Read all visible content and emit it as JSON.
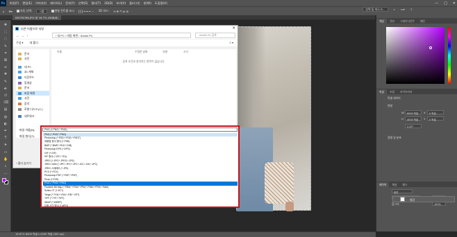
{
  "menubar": {
    "logo": "Ps",
    "items": [
      "파일(F)",
      "편집(E)",
      "이미지(I)",
      "레이어(L)",
      "문자(Y)",
      "선택(S)",
      "필터(T)",
      "3D(D)",
      "보기(V)",
      "플러그인",
      "창(W)",
      "도움말(H)"
    ]
  },
  "window_controls": {
    "minimize": "—",
    "maximize": "□",
    "close": "✕"
  },
  "options": {
    "auto_select_label": "자동 선택:",
    "auto_select_value": "그룹",
    "transform_label": "변형 컨트롤 표시",
    "mode_label": "3D 모드:",
    "select_mask_button": "선택 및 마스크..."
  },
  "document_tab": {
    "label": "DSCF8766.JPG @ 16.7% (RGB/8)"
  },
  "dialog": {
    "title": "다른 이름으로 저장",
    "close_icon": "✕",
    "nav_arrows": [
      "←",
      "→",
      "↑"
    ],
    "breadcrumb": "›  내 PC  ›  바탕 화면  ›  Adobe Ps",
    "search_placeholder": "Adobe Ps 검색",
    "organize_label": "구성 ▾",
    "new_folder_label": "새 폴더",
    "view_label": "≡ ▾",
    "sidebar_items": [
      {
        "label": "문서",
        "color": "#dcb35c"
      },
      {
        "label": "사진",
        "color": "#dcb35c"
      },
      {
        "label": "내 PC",
        "color": "#5a9fd4"
      },
      {
        "label": "3D 개체",
        "color": "#4aa3df"
      },
      {
        "label": "다운로드",
        "color": "#3c8edb"
      },
      {
        "label": "동영상",
        "color": "#8a63c9"
      },
      {
        "label": "문서",
        "color": "#dcb35c"
      },
      {
        "label": "바탕 화면",
        "color": "#3f8fd8"
      },
      {
        "label": "사진",
        "color": "#4aa3df"
      },
      {
        "label": "음악",
        "color": "#e07a3c"
      },
      {
        "label": "로컬 디스크 (C:)",
        "color": "#8d8d8d"
      },
      {
        "label": "네트워크",
        "color": "#4c7cb8"
      }
    ],
    "columns": [
      "이름",
      "수정한 날짜",
      "유형",
      "크기"
    ],
    "empty_message": "검색 조건과 일치하는 항목이 없습니다.",
    "filename_label": "파일 이름(N):",
    "filetype_label": "파일 형식(T):",
    "hide_folders_label": "^ 폴더 숨기기"
  },
  "filetype_dropdown": {
    "current": "PNG (*.PNG;*.PNG)",
    "options": [
      "PNG (*.PNG;*.PNG)",
      "Photoshop (*.PSD;*.PDD;*.PSDT)",
      "대용량 문서 형식 (*.PSB)",
      "BMP (*.BMP;*.RLE;*.DIB)",
      "Photoshop EPS (*.EPS)",
      "GIF (*.GIF)",
      "IFF 형식 (*.IFF;*.TDI)",
      "JPEG (*.JPG;*.JPEG;*.JPE)",
      "JPEG 2000 (*.JPF;*.JPX;*.JP2;*.J2C;*.J2K;*.JPC)",
      "JPEG 스테레오 (*.JPS)",
      "PCX (*.PCX)",
      "Photoshop PDF (*.PDF;*.PDP)",
      "Pixar (*.PXR)",
      "PNG (*.PNG;*.PNG)",
      "Portable Bit Map (*.PBM;*.PGM;*.PPM;*.PNM;*.PFM;*.PAM)",
      "Scitex CT (*.SCT)",
      "Targa (*.TGA;*.VDA;*.ICB;*.VST)",
      "TIFF (*.TIF;*.TIFF)",
      "WebP (*.WEBP)",
      "다중 사진 형식 (*.MPO)"
    ],
    "highlighted_index": 13
  },
  "right_panel": {
    "color_tabs": [
      "색상",
      "견본",
      "그레이디언트",
      "패턴"
    ],
    "props_tabs": [
      "속성",
      "조정",
      "라이브러리"
    ],
    "props_title": "픽셀 레이어",
    "transform_label": "변형",
    "w_label": "W",
    "h_label": "H",
    "w_value": "6000 픽셀",
    "h_value": "4000 픽셀",
    "x_label": "X",
    "y_label": "Y",
    "x_value": "0 픽셀",
    "y_value": "0 픽셀",
    "angle_value": "0.00°",
    "align_label": "정렬 및 분포",
    "layers_tabs": [
      "레이어",
      "채널",
      "패스"
    ],
    "layer_kind": "종류",
    "blend_mode": "표준",
    "opacity": "100%",
    "lock_label": "잠그기:",
    "fill": "100%",
    "layer_name": "배경"
  },
  "status": {
    "text": "16.67%    6000 픽셀 x 4000 픽셀 (300 ppi)"
  },
  "tools": [
    "move-icon",
    "marquee-icon",
    "lasso-icon",
    "quick-select-icon",
    "crop-icon",
    "frame-icon",
    "eyedropper-icon",
    "healing-icon",
    "brush-icon",
    "stamp-icon",
    "history-brush-icon",
    "eraser-icon",
    "gradient-icon",
    "blur-icon",
    "dodge-icon",
    "pen-icon",
    "type-icon",
    "path-select-icon",
    "shape-icon",
    "hand-icon",
    "zoom-icon",
    "more-icon"
  ],
  "tool_glyphs": [
    "✥",
    "⬚",
    "◌",
    "✎",
    "⌗",
    "⊠",
    "⌀",
    "✚",
    "✎",
    "⎆",
    "↺",
    "⌫",
    "▤",
    "◍",
    "◐",
    "✒",
    "T",
    "➤",
    "▭",
    "✋",
    "⌕",
    "…"
  ],
  "colors": {
    "foreground": "#b400ff",
    "background": "#000000",
    "accent_red": "#c1141b",
    "highlight": "#0078d7"
  }
}
